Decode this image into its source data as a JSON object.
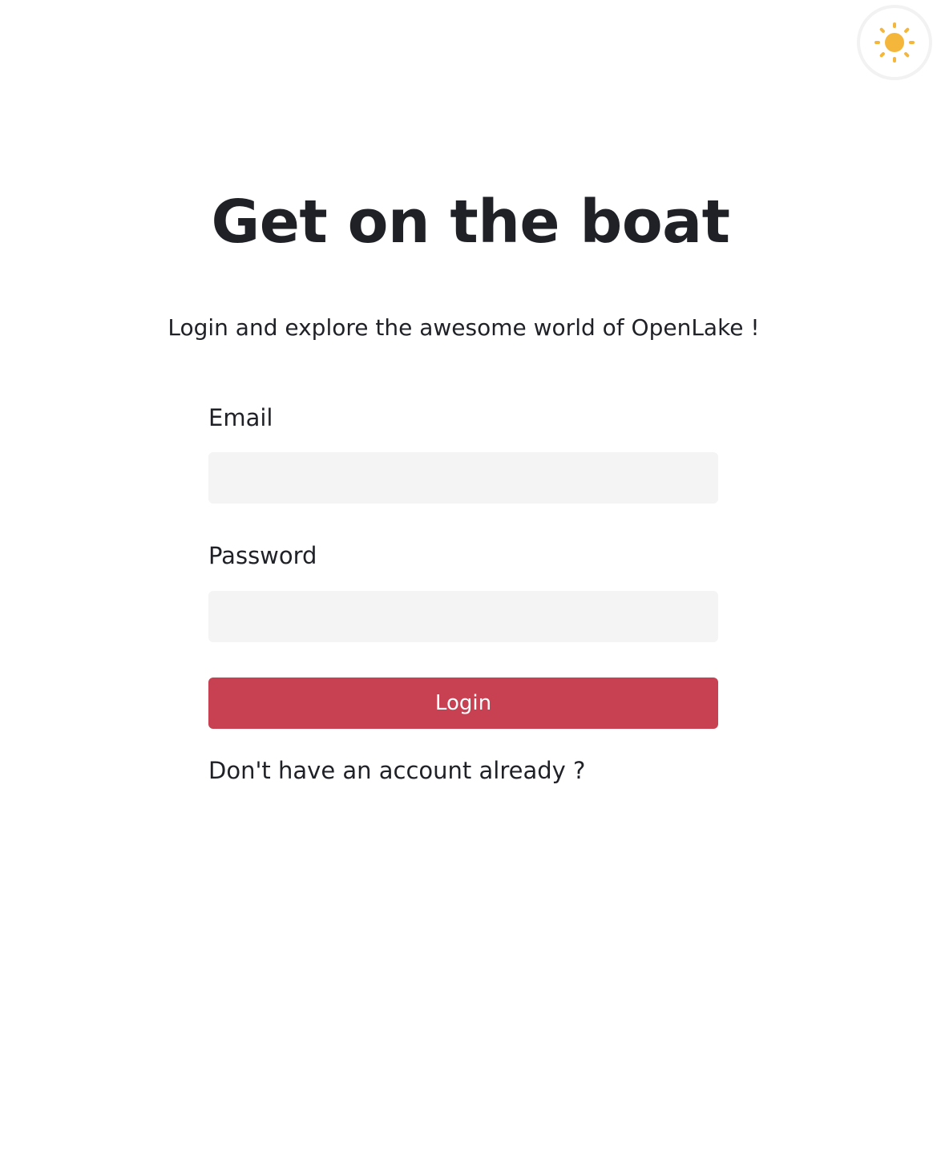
{
  "theme_toggle": {
    "icon": "sun-icon",
    "icon_color": "#f4b63b"
  },
  "header": {
    "title": "Get on the boat",
    "subtitle": "Login and explore the awesome world of OpenLake !"
  },
  "form": {
    "email_label": "Email",
    "email_value": "",
    "password_label": "Password",
    "password_value": "",
    "login_label": "Login",
    "signup_prompt": "Don't have an account already ?"
  },
  "colors": {
    "accent": "#c84152",
    "input_background": "#f4f4f4",
    "text": "#1f2127"
  }
}
